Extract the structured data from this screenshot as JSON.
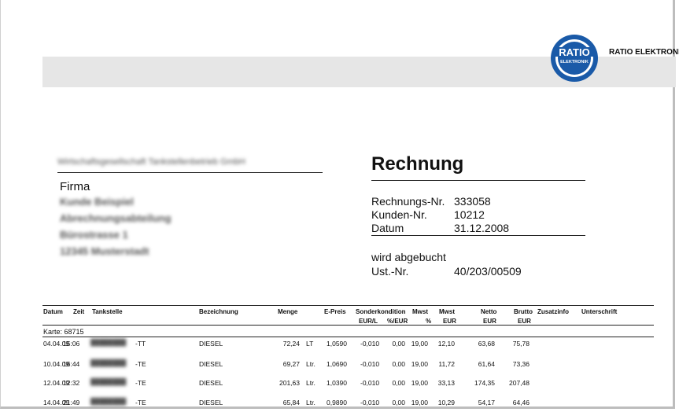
{
  "company": {
    "name": "RATIO ELEKTRONI",
    "logo_text_top": "RATIO",
    "logo_text_bottom": "ELEKTRONIK"
  },
  "sender_line": "Wirtschaftsgesellschaft Tankstellenbetrieb GmbH",
  "recipient": {
    "firma": "Firma",
    "blurred_lines": [
      "Kunde Beispiel",
      "Abrechnungsabteilung",
      "Bürostrasse 1",
      "12345 Musterstadt"
    ]
  },
  "invoice": {
    "title": "Rechnung",
    "rechnungs_nr_label": "Rechnungs-Nr.",
    "rechnungs_nr": "333058",
    "kunden_nr_label": "Kunden-Nr.",
    "kunden_nr": "10212",
    "datum_label": "Datum",
    "datum": "31.12.2008",
    "payment": "wird abgebucht",
    "ust_label": "Ust.-Nr.",
    "ust": "40/203/00509"
  },
  "table": {
    "headers": {
      "datum": "Datum",
      "zeit": "Zeit",
      "tankstelle": "Tankstelle",
      "bezeichnung": "Bezeichnung",
      "menge": "Menge",
      "epreis": "E-Preis",
      "sonderkondition": "Sonderkondition",
      "mwst1": "Mwst",
      "mwst2": "Mwst",
      "netto": "Netto",
      "brutto": "Brutto",
      "zusatzinfo": "Zusatzinfo",
      "unterschrift": "Unterschrift",
      "sub_eur_l": "EUR/L",
      "sub_pct_eur": "%/EUR",
      "sub_pct": "%",
      "sub_eur1": "EUR",
      "sub_eur2": "EUR",
      "sub_eur3": "EUR"
    },
    "karte": "Karte: 68715",
    "rows": [
      {
        "datum": "04.04.09",
        "zeit": "15:06",
        "tankstelle_suffix": "-TT",
        "bezeichnung": "DIESEL",
        "menge": "72,24",
        "einheit": "LT",
        "epreis": "1,0590",
        "sonder": "-0,010",
        "pct": "0,00",
        "mwst_pct": "19,00",
        "mwst_eur": "12,10",
        "netto": "63,68",
        "brutto": "75,78"
      },
      {
        "datum": "10.04.09",
        "zeit": "16:44",
        "tankstelle_suffix": "-TE",
        "bezeichnung": "DIESEL",
        "menge": "69,27",
        "einheit": "Ltr.",
        "epreis": "1,0690",
        "sonder": "-0,010",
        "pct": "0,00",
        "mwst_pct": "19,00",
        "mwst_eur": "11,72",
        "netto": "61,64",
        "brutto": "73,36"
      },
      {
        "datum": "12.04.09",
        "zeit": "12:32",
        "tankstelle_suffix": "-TE",
        "bezeichnung": "DIESEL",
        "menge": "201,63",
        "einheit": "Ltr.",
        "epreis": "1,0390",
        "sonder": "-0,010",
        "pct": "0,00",
        "mwst_pct": "19,00",
        "mwst_eur": "33,13",
        "netto": "174,35",
        "brutto": "207,48"
      },
      {
        "datum": "14.04.09",
        "zeit": "21:49",
        "tankstelle_suffix": "-TE",
        "bezeichnung": "DIESEL",
        "menge": "65,84",
        "einheit": "Ltr.",
        "epreis": "0,9890",
        "sonder": "-0,010",
        "pct": "0,00",
        "mwst_pct": "19,00",
        "mwst_eur": "10,29",
        "netto": "54,17",
        "brutto": "64,46"
      }
    ]
  },
  "colors": {
    "logo_blue": "#1a5aa8",
    "band_gray": "#e6e6e6"
  }
}
